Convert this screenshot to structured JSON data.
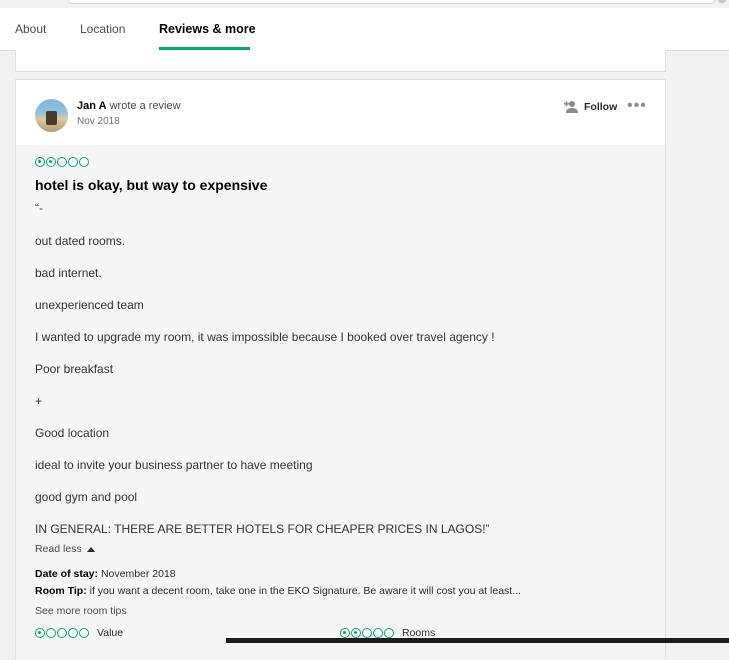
{
  "tabs": [
    {
      "label": "About",
      "active": false
    },
    {
      "label": "Location",
      "active": false
    },
    {
      "label": "Reviews & more",
      "active": true
    }
  ],
  "review": {
    "author": "Jan A",
    "action": "wrote a review",
    "date": "Nov 2018",
    "follow_label": "Follow",
    "more_icon": "ellipsis-icon",
    "rating": 2,
    "rating_max": 5,
    "title": "hotel is okay, but way to expensive",
    "paragraphs": [
      "“-",
      "out dated rooms.",
      "bad internet.",
      "unexperienced team",
      "I wanted to upgrade my room, it was impossible because I booked over travel agency !",
      "Poor breakfast",
      "+",
      "Good location",
      "ideal to invite your business partner to have meeting",
      "good gym and pool",
      "IN GENERAL: THERE ARE BETTER HOTELS FOR CHEAPER PRICES IN LAGOS!”"
    ],
    "read_less": "Read less",
    "date_of_stay_label": "Date of stay:",
    "date_of_stay": "November 2018",
    "room_tip_label": "Room Tip:",
    "room_tip": "if you want a decent room, take one in the EKO Signature. Be aware it will cost you at least...",
    "see_more_tips": "See more room tips",
    "subratings": [
      {
        "label": "Value",
        "rating": 1
      },
      {
        "label": "Rooms",
        "rating": 2
      }
    ]
  },
  "colors": {
    "accent": "#00aa6c",
    "text": "#2c2c2c"
  }
}
